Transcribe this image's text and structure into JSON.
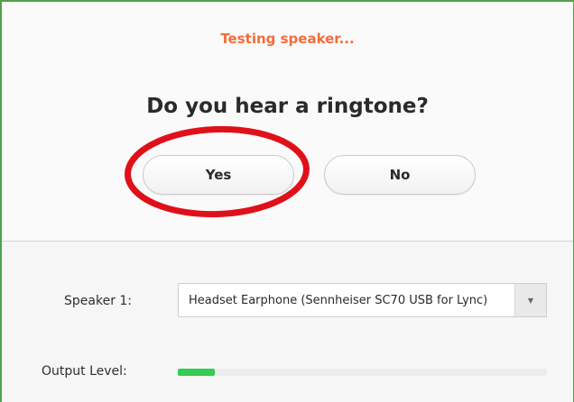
{
  "status": "Testing speaker...",
  "question": "Do you hear a ringtone?",
  "buttons": {
    "yes": "Yes",
    "no": "No"
  },
  "speaker": {
    "label": "Speaker 1:",
    "selected": "Headset Earphone (Sennheiser SC70 USB for Lync)",
    "arrow_icon": "chevron-down-icon"
  },
  "output": {
    "label": "Output Level:",
    "level_fraction": 0.1
  },
  "colors": {
    "status": "#f26d3b",
    "annotation_circle": "#e0101a",
    "level_fill": "#32cd52",
    "window_border": "#4fa24a"
  }
}
